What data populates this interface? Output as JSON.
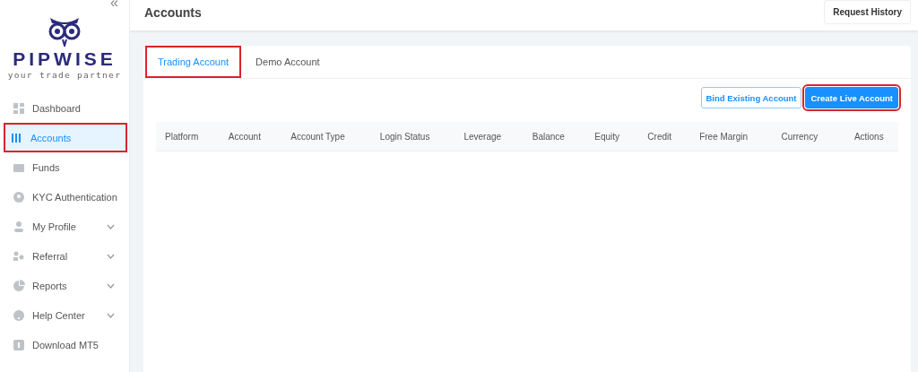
{
  "sidebar": {
    "collapse": "«",
    "logo": {
      "name": "PIPWISE",
      "tagline": "your trade partner"
    },
    "items": [
      {
        "label": "Dashboard",
        "selected": false,
        "highlighted": false,
        "expandable": false
      },
      {
        "label": "Accounts",
        "selected": true,
        "highlighted": true,
        "expandable": false
      },
      {
        "label": "Funds",
        "selected": false,
        "highlighted": false,
        "expandable": false
      },
      {
        "label": "KYC Authentication",
        "selected": false,
        "highlighted": false,
        "expandable": false
      },
      {
        "label": "My Profile",
        "selected": false,
        "highlighted": false,
        "expandable": true
      },
      {
        "label": "Referral",
        "selected": false,
        "highlighted": false,
        "expandable": true
      },
      {
        "label": "Reports",
        "selected": false,
        "highlighted": false,
        "expandable": true
      },
      {
        "label": "Help Center",
        "selected": false,
        "highlighted": false,
        "expandable": true
      },
      {
        "label": "Download MT5",
        "selected": false,
        "highlighted": false,
        "expandable": false
      }
    ]
  },
  "header": {
    "title": "Accounts",
    "button": "Request History"
  },
  "tabs": [
    {
      "label": "Trading Account",
      "selected": true,
      "highlighted": true
    },
    {
      "label": "Demo Account",
      "selected": false,
      "highlighted": false
    }
  ],
  "actions": [
    {
      "label": "Bind Existing Account",
      "kind": "outline",
      "highlighted": false
    },
    {
      "label": "Create Live Account",
      "kind": "primary",
      "highlighted": true
    }
  ],
  "table": {
    "columns": [
      "Platform",
      "Account",
      "Account Type",
      "Login Status",
      "Leverage",
      "Balance",
      "Equity",
      "Credit",
      "Free Margin",
      "Currency",
      "Actions"
    ]
  }
}
